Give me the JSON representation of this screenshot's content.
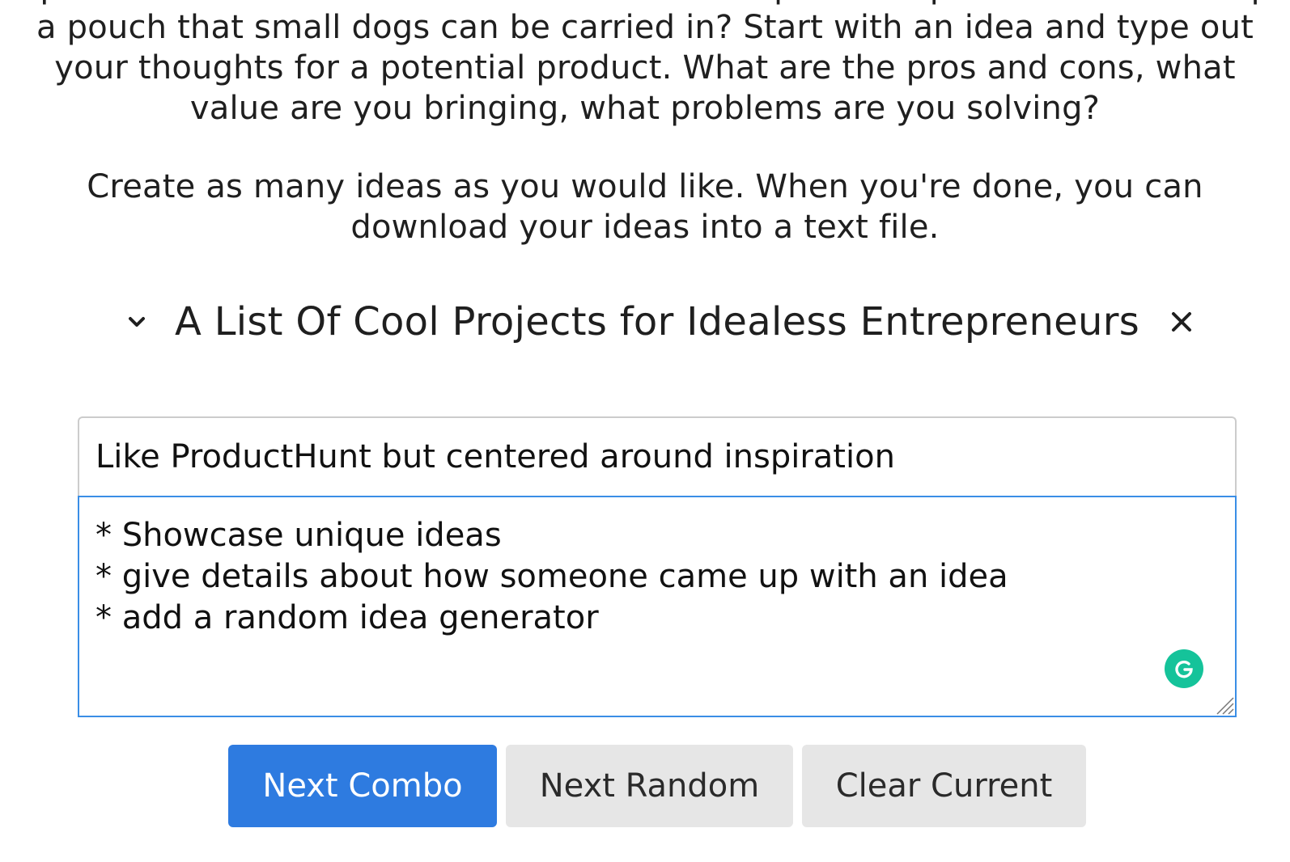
{
  "intro": {
    "lines": [
      "Explore combinations of words and brainstorm potential products—for example,",
      "a pouch that small dogs can be carried in? Start with an idea and type out",
      "your thoughts for a potential product. What are the pros and cons, what",
      "value are you bringing, what problems are you solving?"
    ],
    "second_lines": [
      "Create as many ideas as you would like. When you're done, you can",
      "download your ideas into a text file."
    ]
  },
  "list": {
    "title": "A List Of Cool Projects for Idealess Entrepreneurs",
    "toggle_icon": "chevron-down-icon",
    "close_icon": "close-icon"
  },
  "idea": {
    "title_value": "Like ProductHunt but centered around inspiration",
    "notes_value": "* Showcase unique ideas\n* give details about how someone came up with an idea\n* add a random idea generator",
    "assistant_icon": "grammarly-icon"
  },
  "buttons": {
    "next_combo": "Next Combo",
    "next_random": "Next Random",
    "clear_current": "Clear Current"
  },
  "colors": {
    "primary_button": "#2e7be0",
    "secondary_button": "#e6e6e6",
    "focus_border": "#3a8ee6",
    "grammarly": "#15c39a"
  }
}
